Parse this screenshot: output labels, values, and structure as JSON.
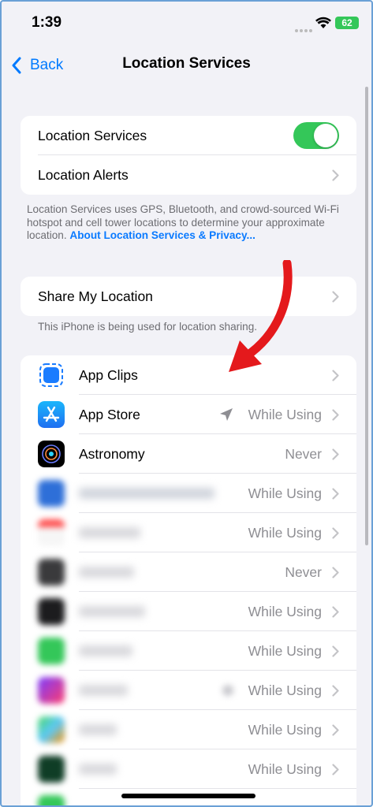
{
  "status": {
    "time": "1:39",
    "battery": "62"
  },
  "nav": {
    "back_label": "Back",
    "title": "Location Services"
  },
  "main_group": {
    "location_services_label": "Location Services",
    "location_alerts_label": "Location Alerts"
  },
  "footnote1": {
    "text": "Location Services uses GPS, Bluetooth, and crowd-sourced Wi-Fi hotspot and cell tower locations to determine your approximate location. ",
    "link": "About Location Services & Privacy..."
  },
  "share": {
    "label": "Share My Location",
    "footnote": "This iPhone is being used for location sharing."
  },
  "apps": [
    {
      "label": "App Clips",
      "value": ""
    },
    {
      "label": "App Store",
      "value": "While Using"
    },
    {
      "label": "Astronomy",
      "value": "Never"
    },
    {
      "label": "",
      "value": "While Using"
    },
    {
      "label": "",
      "value": "While Using"
    },
    {
      "label": "",
      "value": "Never"
    },
    {
      "label": "",
      "value": "While Using"
    },
    {
      "label": "",
      "value": "While Using"
    },
    {
      "label": "",
      "value": "While Using"
    },
    {
      "label": "",
      "value": "While Using"
    },
    {
      "label": "",
      "value": "While Using"
    }
  ],
  "colors": {
    "accent": "#007aff",
    "toggle_on": "#34c759",
    "annotation_arrow": "#e4191c"
  }
}
